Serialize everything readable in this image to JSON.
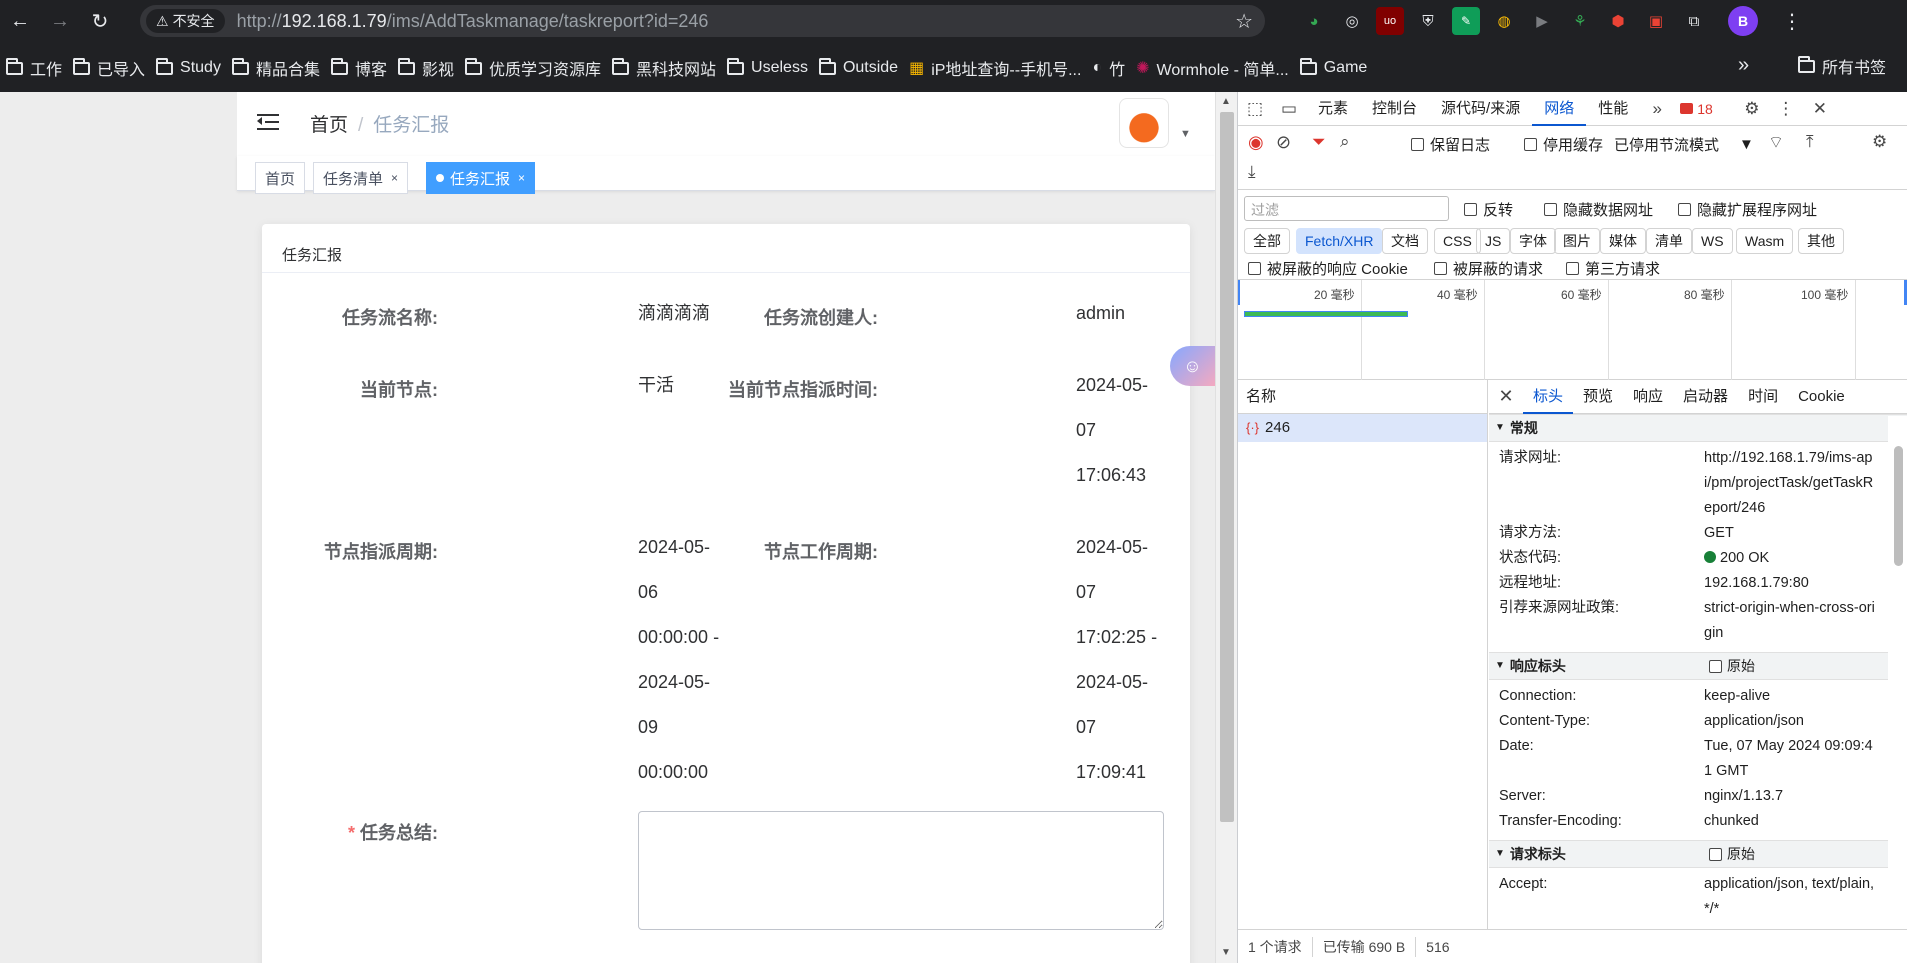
{
  "browser": {
    "security_label": "不安全",
    "url_prefix": "http://",
    "url_host": "192.168.1.79",
    "url_path": "/ims/AddTaskmanage/taskreport?id=246",
    "profile_initial": "B",
    "bookmarks": [
      "工作",
      "已导入",
      "Study",
      "精品合集",
      "博客",
      "影视",
      "优质学习资源库",
      "黑科技网站",
      "Useless",
      "Outside",
      "iP地址查询--手机号...",
      "竹",
      "Wormhole - 简单...",
      "Game"
    ],
    "bookmarks_all": "所有书签"
  },
  "app": {
    "breadcrumb": {
      "home": "首页",
      "current": "任务汇报"
    },
    "tags": [
      {
        "label": "首页"
      },
      {
        "label": "任务清单",
        "close": "×"
      },
      {
        "label": "任务汇报",
        "close": "×"
      }
    ],
    "card_title": "任务汇报",
    "fields": {
      "flow_name_label": "任务流名称:",
      "flow_name_value": "滴滴滴滴",
      "creator_label": "任务流创建人:",
      "creator_value": "admin",
      "node_label": "当前节点:",
      "node_value": "干活",
      "assign_time_label": "当前节点指派时间:",
      "assign_time_value": "2024-05-\n07\n17:06:43",
      "assign_period_label": "节点指派周期:",
      "assign_period_value": "2024-05-\n06\n00:00:00 -\n2024-05-\n09\n00:00:00",
      "work_period_label": "节点工作周期:",
      "work_period_value": "2024-05-\n07\n17:02:25 -\n2024-05-\n07\n17:09:41",
      "summary_required": "*",
      "summary_label": "任务总结:"
    }
  },
  "devtools": {
    "tabs": [
      "元素",
      "控制台",
      "源代码/来源",
      "网络",
      "性能"
    ],
    "error_count": "18",
    "toolbar": {
      "preserve_log": "保留日志",
      "disable_cache": "停用缓存",
      "throttle": "已停用节流模式"
    },
    "filter": {
      "placeholder": "过滤",
      "invert": "反转",
      "hide_data_urls": "隐藏数据网址",
      "hide_ext_urls": "隐藏扩展程序网址",
      "types": [
        "全部",
        "Fetch/XHR",
        "文档",
        "CSS",
        "JS",
        "字体",
        "图片",
        "媒体",
        "清单",
        "WS",
        "Wasm",
        "其他"
      ],
      "blocked_cookies": "被屏蔽的响应 Cookie",
      "blocked_requests": "被屏蔽的请求",
      "third_party": "第三方请求"
    },
    "timeline_ticks": [
      "20 毫秒",
      "40 毫秒",
      "60 毫秒",
      "80 毫秒",
      "100 毫秒"
    ],
    "list": {
      "name_header": "名称",
      "request_name": "246",
      "footer_requests": "1 个请求",
      "footer_transferred": "已传输 690 B",
      "footer_size": "516"
    },
    "detail_tabs": [
      "标头",
      "预览",
      "响应",
      "启动器",
      "时间",
      "Cookie"
    ],
    "general": {
      "title": "常规",
      "rows": [
        {
          "k": "请求网址:",
          "v": "http://192.168.1.79/ims-api/pm/projectTask/getTaskReport/246"
        },
        {
          "k": "请求方法:",
          "v": "GET"
        },
        {
          "k": "状态代码:",
          "v": "200 OK"
        },
        {
          "k": "远程地址:",
          "v": "192.168.1.79:80"
        },
        {
          "k": "引荐来源网址政策:",
          "v": "strict-origin-when-cross-origin"
        }
      ]
    },
    "response_headers": {
      "title": "响应标头",
      "raw": "原始",
      "rows": [
        {
          "k": "Connection:",
          "v": "keep-alive"
        },
        {
          "k": "Content-Type:",
          "v": "application/json"
        },
        {
          "k": "Date:",
          "v": "Tue, 07 May 2024 09:09:41 GMT"
        },
        {
          "k": "Server:",
          "v": "nginx/1.13.7"
        },
        {
          "k": "Transfer-Encoding:",
          "v": "chunked"
        }
      ]
    },
    "request_headers": {
      "title": "请求标头",
      "raw": "原始",
      "rows": [
        {
          "k": "Accept:",
          "v": "application/json, text/plain, */*"
        }
      ]
    },
    "colors": {
      "accent": "#0b57d0",
      "el_primary": "#409eff",
      "ok": "#188038"
    }
  }
}
